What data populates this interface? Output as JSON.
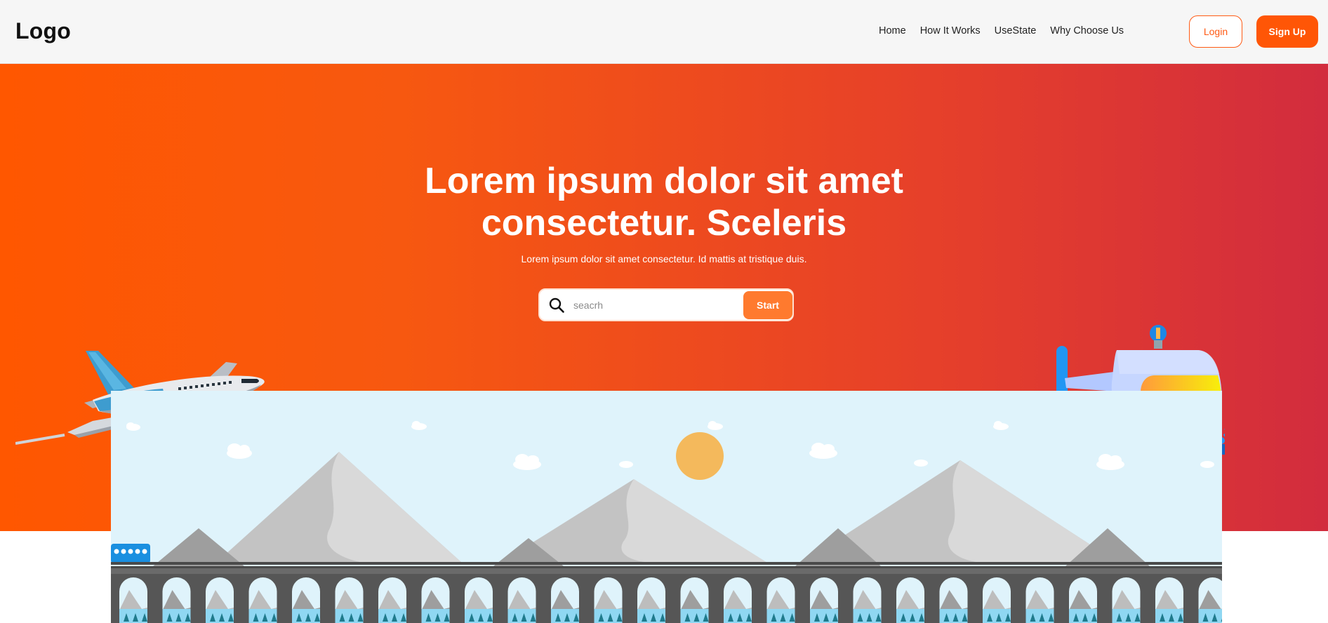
{
  "header": {
    "logo": "Logo",
    "nav": [
      "Home",
      "How It Works",
      "UseState",
      "Why Choose Us"
    ],
    "login_label": "Login",
    "signup_label": "Sign Up"
  },
  "hero": {
    "title_line1": "Lorem ipsum dolor sit amet",
    "title_line2": "consectetur. Sceleris",
    "subtitle": "Lorem ipsum dolor sit amet consectetur. Id mattis at tristique duis.",
    "search": {
      "placeholder": "seacrh",
      "button_label": "Start",
      "icon": "search-icon"
    }
  },
  "colors": {
    "accent": "#ff5606",
    "gradient_start": "#ff5700",
    "gradient_end": "#d22c3e",
    "sky": "#dff3fb"
  }
}
